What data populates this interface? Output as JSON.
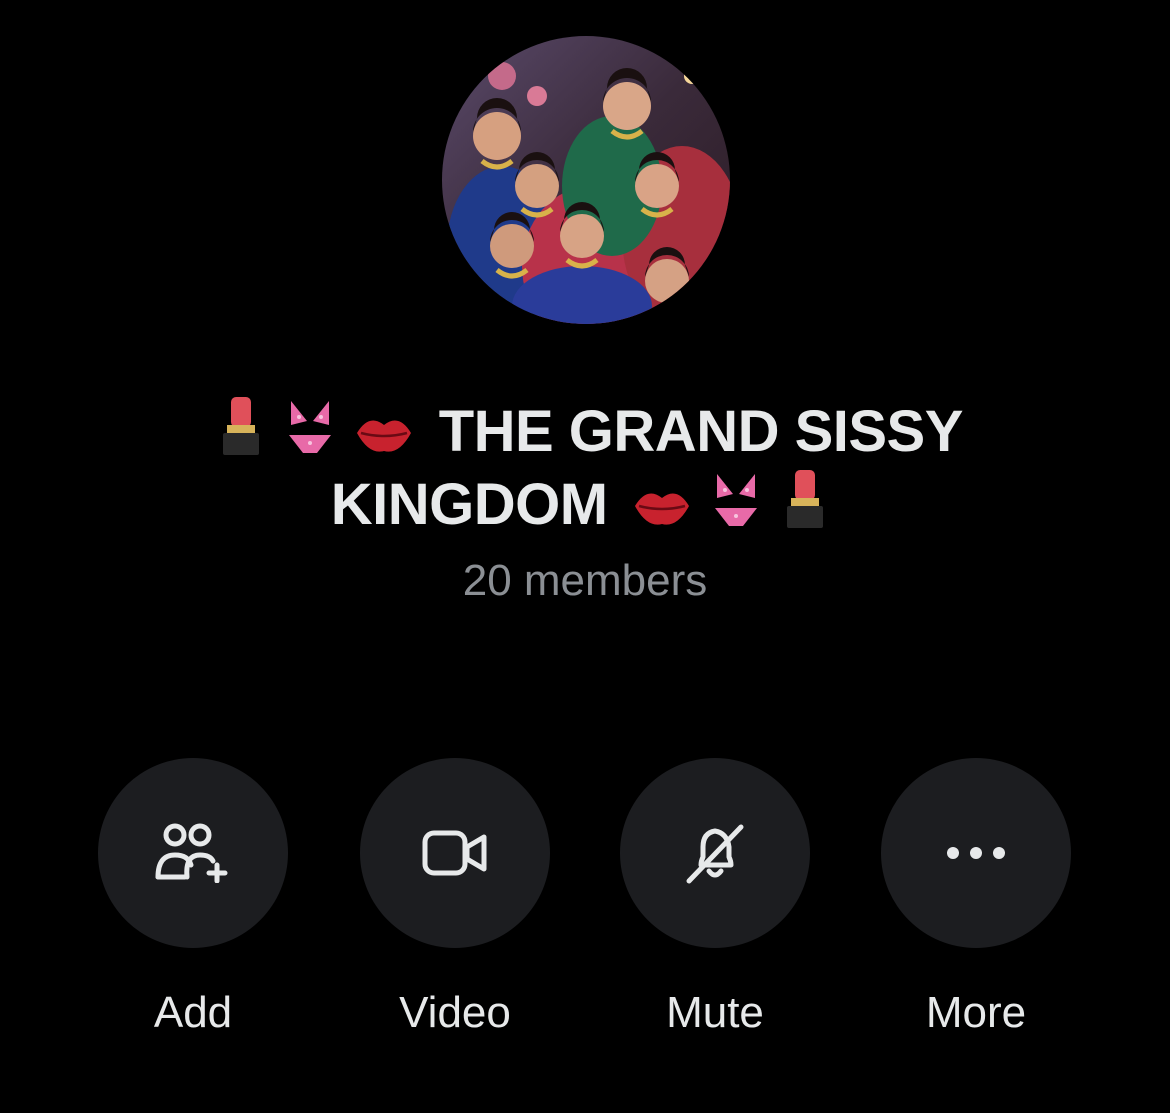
{
  "group": {
    "name_left_emojis": [
      "lipstick",
      "bikini",
      "kiss-mark"
    ],
    "name_line1": "THE GRAND SISSY",
    "name_line2": "KINGDOM",
    "name_right_emojis": [
      "kiss-mark",
      "bikini",
      "lipstick"
    ],
    "members": "20 members"
  },
  "actions": [
    {
      "label": "Add",
      "icon": "add-people-icon"
    },
    {
      "label": "Video",
      "icon": "video-camera-icon"
    },
    {
      "label": "Mute",
      "icon": "bell-slash-icon"
    },
    {
      "label": "More",
      "icon": "ellipsis-icon"
    }
  ],
  "colors": {
    "background": "#000000",
    "button_bg": "#1c1d20",
    "text": "#e7e9ea",
    "muted_text": "#8b8f94"
  }
}
